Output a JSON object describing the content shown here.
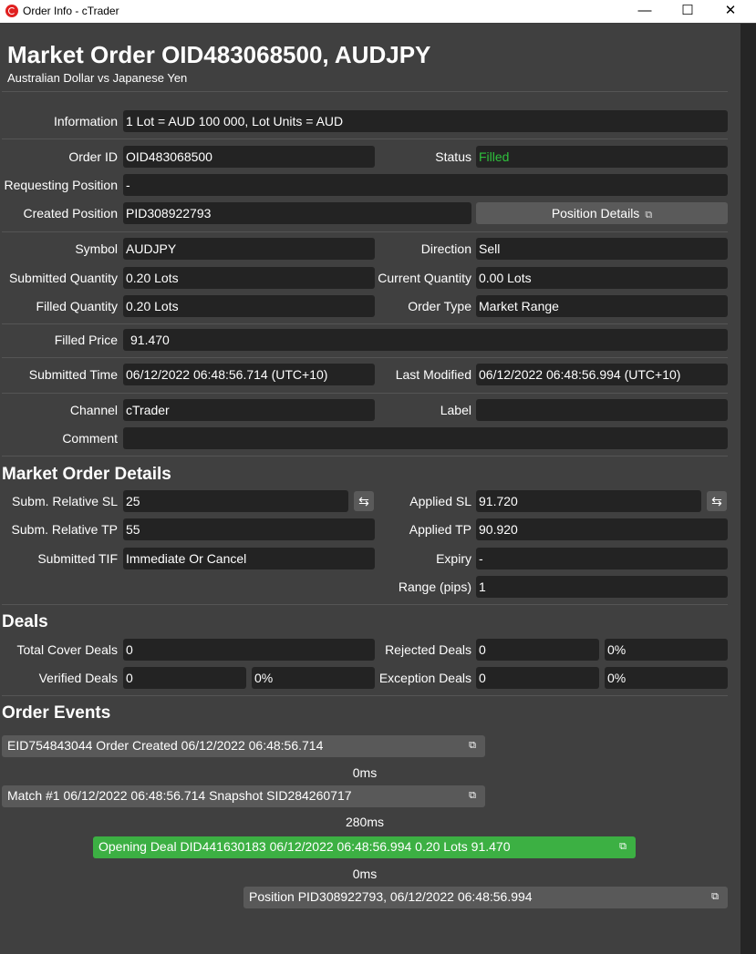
{
  "window": {
    "title": "Order Info - cTrader",
    "minimize": "—",
    "maximize": "☐",
    "close": "✕"
  },
  "header": {
    "title": "Market Order OID483068500, AUDJPY",
    "subtitle": "Australian Dollar vs Japanese Yen"
  },
  "info": {
    "label": "Information",
    "value": "1 Lot = AUD 100 000, Lot Units = AUD"
  },
  "order": {
    "order_id_label": "Order ID",
    "order_id": "OID483068500",
    "status_label": "Status",
    "status": "Filled",
    "requesting_label": "Requesting Position",
    "requesting": "-",
    "created_label": "Created Position",
    "created": "PID308922793",
    "position_details": "Position Details"
  },
  "trade": {
    "symbol_label": "Symbol",
    "symbol": "AUDJPY",
    "direction_label": "Direction",
    "direction": "Sell",
    "submitted_qty_label": "Submitted Quantity",
    "submitted_qty": "0.20 Lots",
    "current_qty_label": "Current Quantity",
    "current_qty": "0.00 Lots",
    "filled_qty_label": "Filled Quantity",
    "filled_qty": "0.20 Lots",
    "order_type_label": "Order Type",
    "order_type": "Market Range",
    "filled_price_label": "Filled Price",
    "filled_price": "91.470",
    "submitted_time_label": "Submitted Time",
    "submitted_time": "06/12/2022 06:48:56.714 (UTC+10)",
    "last_modified_label": "Last Modified",
    "last_modified": "06/12/2022 06:48:56.994 (UTC+10)",
    "channel_label": "Channel",
    "channel": "cTrader",
    "label_label": "Label",
    "label": "",
    "comment_label": "Comment",
    "comment": ""
  },
  "market_details": {
    "title": "Market Order Details",
    "subm_sl_label": "Subm. Relative SL",
    "subm_sl": "25",
    "applied_sl_label": "Applied SL",
    "applied_sl": "91.720",
    "subm_tp_label": "Subm. Relative TP",
    "subm_tp": "55",
    "applied_tp_label": "Applied TP",
    "applied_tp": "90.920",
    "tif_label": "Submitted TIF",
    "tif": "Immediate Or Cancel",
    "expiry_label": "Expiry",
    "expiry": "-",
    "range_label": "Range (pips)",
    "range": "1"
  },
  "deals": {
    "title": "Deals",
    "total_cover_label": "Total Cover Deals",
    "total_cover": "0",
    "rejected_label": "Rejected Deals",
    "rejected": "0",
    "rejected_pct": "0%",
    "verified_label": "Verified Deals",
    "verified": "0",
    "verified_pct": "0%",
    "exception_label": "Exception Deals",
    "exception": "0",
    "exception_pct": "0%"
  },
  "events": {
    "title": "Order Events",
    "items": [
      {
        "text": "EID754843044 Order Created 06/12/2022 06:48:56.714"
      },
      {
        "text": "Match #1 06/12/2022 06:48:56.714 Snapshot SID284260717"
      },
      {
        "text": "Opening Deal DID441630183 06/12/2022 06:48:56.994 0.20 Lots 91.470"
      },
      {
        "text": "Position PID308922793, 06/12/2022 06:48:56.994"
      }
    ],
    "gaps": [
      "0ms",
      "280ms",
      "0ms"
    ]
  }
}
